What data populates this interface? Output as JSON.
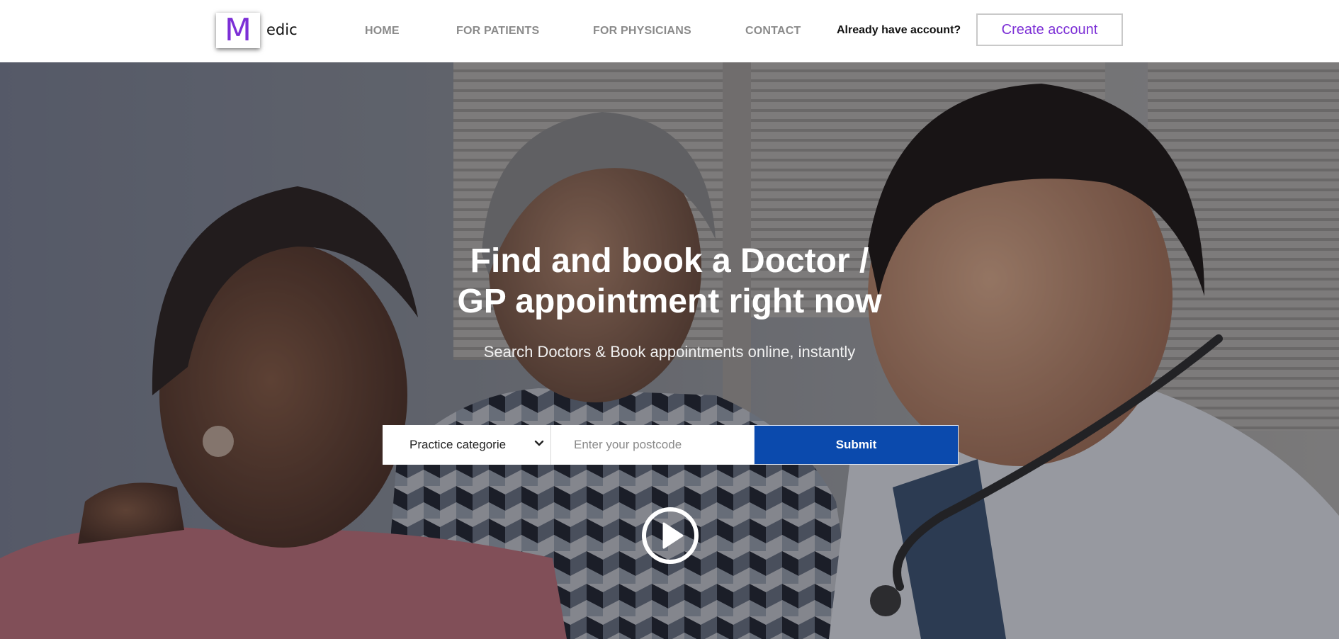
{
  "brand": {
    "logo_letter": "M",
    "logo_text": "edic",
    "accent": "#7c2fd6"
  },
  "nav": {
    "items": [
      {
        "label": "HOME"
      },
      {
        "label": "FOR PATIENTS"
      },
      {
        "label": "FOR PHYSICIANS"
      },
      {
        "label": "CONTACT"
      }
    ],
    "already_account": "Already have account?",
    "create_account": "Create account"
  },
  "hero": {
    "headline_line1": "Find and book a Doctor /",
    "headline_line2": "GP appointment right now",
    "subline": "Search Doctors & Book appointments online, instantly",
    "play_icon": "play-circle-icon"
  },
  "search": {
    "category_selected": "Practice categorie",
    "postcode_placeholder": "Enter your postcode",
    "submit_label": "Submit",
    "submit_color": "#0b4aad"
  }
}
